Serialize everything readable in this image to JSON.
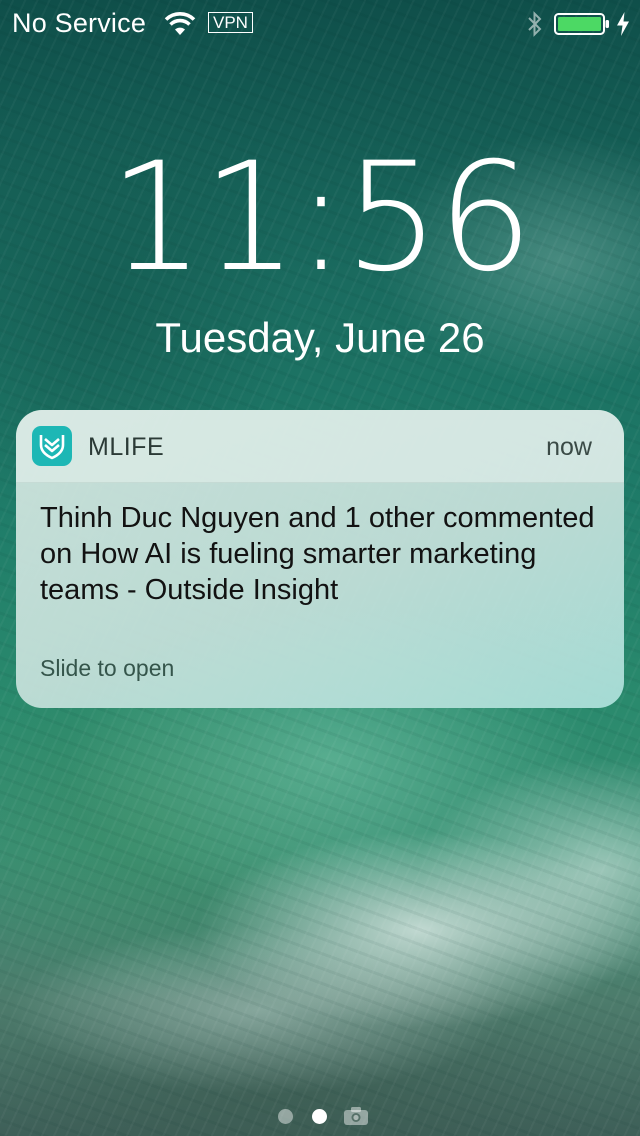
{
  "status_bar": {
    "carrier": "No Service",
    "vpn": "VPN",
    "icons": [
      "wifi-icon",
      "bluetooth-icon",
      "battery-icon",
      "charging-icon"
    ],
    "battery_color": "#4cd964"
  },
  "lock_screen": {
    "time": "11:56",
    "date": "Tuesday, June 26"
  },
  "notification": {
    "app_icon": "mlife-app-icon",
    "app_icon_color": "#1db7b5",
    "app_name": "MLIFE",
    "time": "now",
    "message": "Thinh Duc Nguyen and 1 other commented on How AI is fueling smarter marketing teams - Outside Insight",
    "action": "Slide to open"
  },
  "page_indicator": {
    "pages": 2,
    "current": 2,
    "extra_icon": "camera-icon"
  }
}
